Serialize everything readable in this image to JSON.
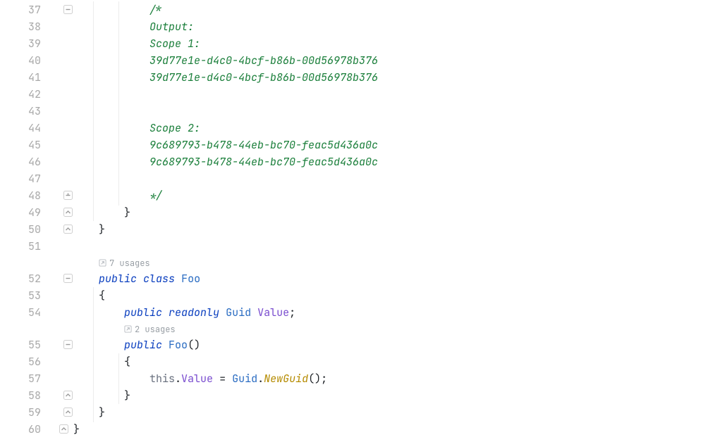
{
  "gutter": {
    "l37": "37",
    "l38": "38",
    "l39": "39",
    "l40": "40",
    "l41": "41",
    "l42": "42",
    "l43": "43",
    "l44": "44",
    "l45": "45",
    "l46": "46",
    "l47": "47",
    "l48": "48",
    "l49": "49",
    "l50": "50",
    "l51": "51",
    "l52": "52",
    "l53": "53",
    "l54": "54",
    "l55": "55",
    "l56": "56",
    "l57": "57",
    "l58": "58",
    "l59": "59",
    "l60": "60"
  },
  "hints": {
    "classUsages": "7 usages",
    "ctorUsages": "2 usages"
  },
  "code": {
    "commentOpen": "/*",
    "commentOutput": "Output:",
    "commentScope1": "Scope 1:",
    "commentGuid1a": "39d77e1e-d4c0-4bcf-b86b-00d56978b376",
    "commentGuid1b": "39d77e1e-d4c0-4bcf-b86b-00d56978b376",
    "commentScope2": "Scope 2:",
    "commentGuid2a": "9c689793-b478-44eb-bc70-feac5d436a0c",
    "commentGuid2b": "9c689793-b478-44eb-bc70-feac5d436a0c",
    "commentClose": "*/",
    "brace49": "}",
    "brace50": "}",
    "kwPublic": "public",
    "kwClass": "class",
    "kwReadonly": "readonly",
    "kwThis": "this",
    "typeGuid": "Guid",
    "identFoo": "Foo",
    "identValue": "Value",
    "methodNewGuid": "NewGuid",
    "brace53": "{",
    "semicolon": ";",
    "openParen": "(",
    "closeParen": ")",
    "brace56": "{",
    "dot": ".",
    "assign": " = ",
    "brace58": "}",
    "brace59": "}",
    "brace60": "}"
  },
  "indent": {
    "d0": "",
    "d1": "    ",
    "d2": "        ",
    "d3": "            ",
    "sp": " "
  }
}
